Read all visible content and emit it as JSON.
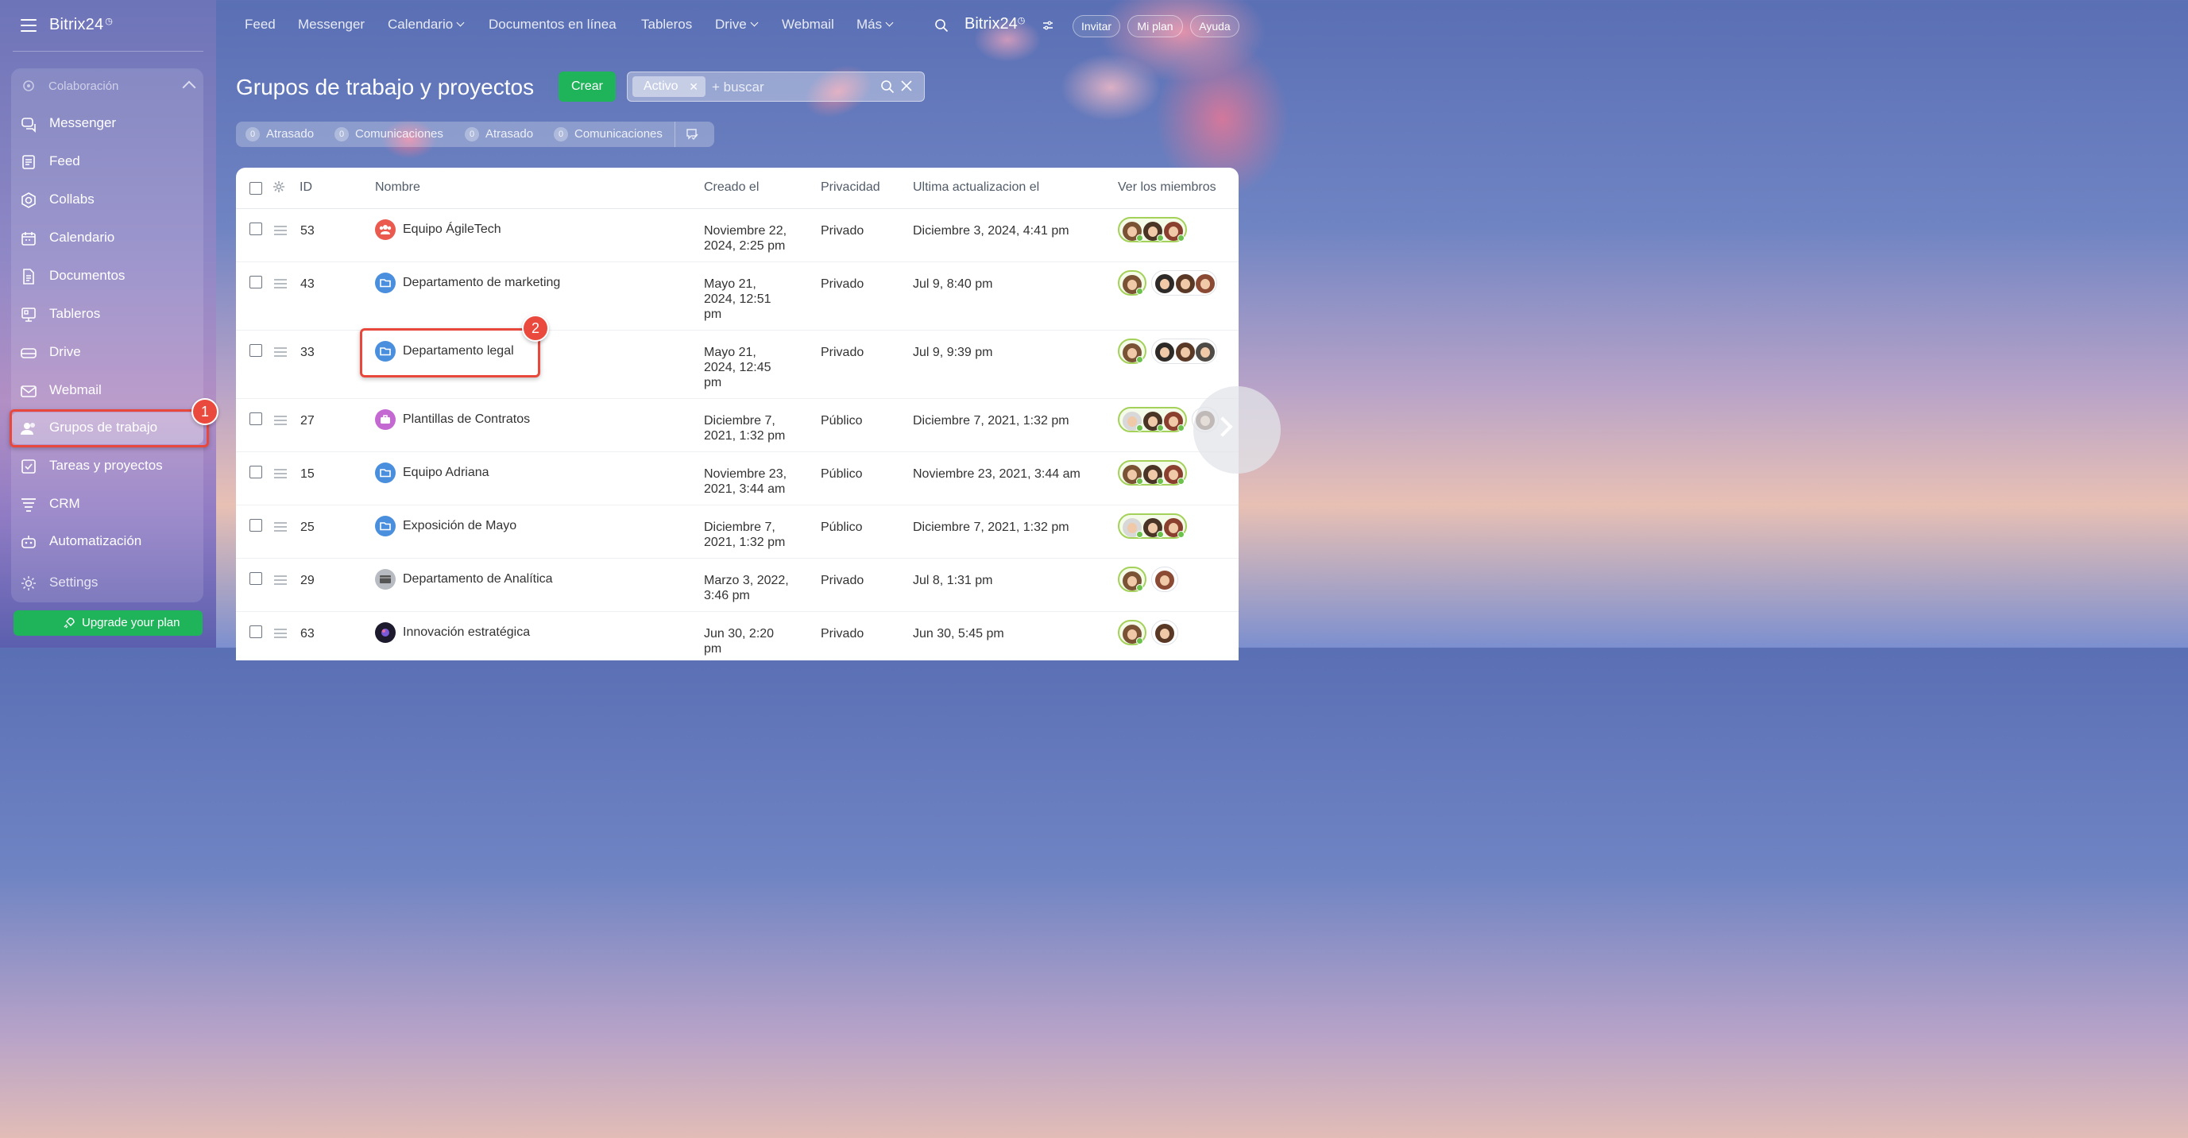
{
  "app": {
    "logo": "Bitrix24",
    "brand": "Bitrix24"
  },
  "sidebar": {
    "section_label": "Colaboración",
    "items": [
      {
        "label": "Messenger",
        "icon": "chat-icon"
      },
      {
        "label": "Feed",
        "icon": "feed-icon"
      },
      {
        "label": "Collabs",
        "icon": "hexagon-icon"
      },
      {
        "label": "Calendario",
        "icon": "calendar-icon"
      },
      {
        "label": "Documentos",
        "icon": "document-icon"
      },
      {
        "label": "Tableros",
        "icon": "board-icon"
      },
      {
        "label": "Drive",
        "icon": "drive-icon"
      },
      {
        "label": "Webmail",
        "icon": "mail-icon"
      },
      {
        "label": "Grupos de trabajo",
        "icon": "people-icon"
      },
      {
        "label": "Tareas y proyectos",
        "icon": "tasks-icon"
      },
      {
        "label": "CRM",
        "icon": "crm-icon"
      },
      {
        "label": "Automatización",
        "icon": "robot-icon"
      }
    ],
    "settings_label": "Settings",
    "upgrade_label": "Upgrade your plan"
  },
  "topnav": {
    "items": [
      "Feed",
      "Messenger",
      "Calendario",
      "Documentos en línea",
      "Tableros",
      "Drive",
      "Webmail",
      "Más"
    ],
    "invite": "Invitar",
    "my_plan": "Mi plan",
    "help": "Ayuda"
  },
  "page": {
    "title": "Grupos de trabajo y proyectos",
    "create_label": "Crear",
    "filter_tag": "Activo",
    "search_placeholder": "+ buscar"
  },
  "counters": [
    {
      "count": "0",
      "label": "Atrasado"
    },
    {
      "count": "0",
      "label": "Comunicaciones"
    },
    {
      "count": "0",
      "label": "Atrasado"
    },
    {
      "count": "0",
      "label": "Comunicaciones"
    }
  ],
  "table": {
    "headers": {
      "id": "ID",
      "name": "Nombre",
      "created": "Creado el",
      "privacy": "Privacidad",
      "updated": "Ultima actualizacion el",
      "members": "Ver los miembros"
    },
    "rows": [
      {
        "id": "53",
        "name": "Equipo ÁgileTech",
        "created": "Noviembre 22, 2024, 2:25 pm",
        "privacy": "Privado",
        "updated": "Diciembre 3, 2024, 4:41 pm"
      },
      {
        "id": "43",
        "name": "Departamento de marketing",
        "created": "Mayo 21, 2024, 12:51 pm",
        "privacy": "Privado",
        "updated": "Jul 9, 8:40 pm"
      },
      {
        "id": "33",
        "name": "Departamento legal",
        "created": "Mayo 21, 2024, 12:45 pm",
        "privacy": "Privado",
        "updated": "Jul 9, 9:39 pm"
      },
      {
        "id": "27",
        "name": "Plantillas de Contratos",
        "created": "Diciembre 7, 2021, 1:32 pm",
        "privacy": "Público",
        "updated": "Diciembre 7, 2021, 1:32 pm"
      },
      {
        "id": "15",
        "name": "Equipo Adriana",
        "created": "Noviembre 23, 2021, 3:44 am",
        "privacy": "Público",
        "updated": "Noviembre 23, 2021, 3:44 am"
      },
      {
        "id": "25",
        "name": "Exposición de Mayo",
        "created": "Diciembre 7, 2021, 1:32 pm",
        "privacy": "Público",
        "updated": "Diciembre 7, 2021, 1:32 pm"
      },
      {
        "id": "29",
        "name": "Departamento de Analítica",
        "created": "Marzo 3, 2022, 3:46 pm",
        "privacy": "Privado",
        "updated": "Jul 8, 1:31 pm"
      },
      {
        "id": "63",
        "name": "Innovación estratégica",
        "created": "Jun 30, 2:20 pm",
        "privacy": "Privado",
        "updated": "Jun 30, 5:45 pm"
      }
    ]
  },
  "annotations": {
    "step1": "1",
    "step2": "2"
  },
  "colors": {
    "accent_green": "#1fb35a",
    "highlight_red": "#e8473c",
    "owner_ring": "#a4d15a"
  }
}
